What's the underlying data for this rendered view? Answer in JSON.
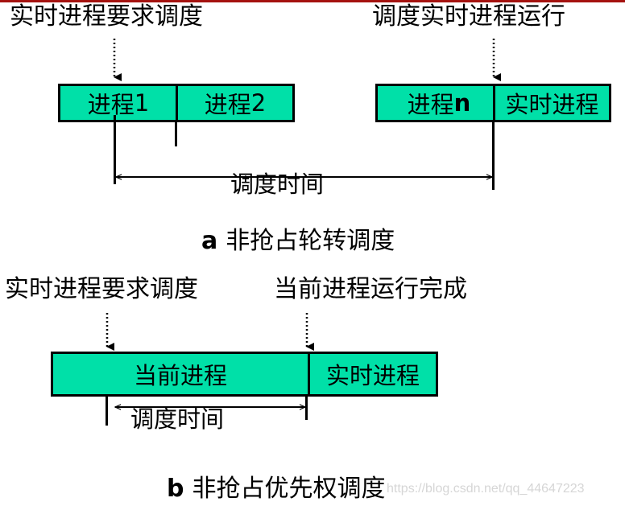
{
  "diagram_a": {
    "label_left": "实时进程要求调度",
    "label_right": "调度实时进程运行",
    "box_left": {
      "cells": [
        {
          "text": "进程",
          "suffix": "1"
        },
        {
          "text": "进程",
          "suffix": "2"
        }
      ]
    },
    "box_right": {
      "cells": [
        {
          "text": "进程",
          "suffix": "n"
        },
        {
          "text": "实时进程",
          "suffix": ""
        }
      ]
    },
    "interval_label": "调度时间",
    "caption_tag": "a",
    "caption_text": "非抢占轮转调度"
  },
  "diagram_b": {
    "label_left": "实时进程要求调度",
    "label_right": "当前进程运行完成",
    "box": {
      "cells": [
        {
          "text": "当前进程"
        },
        {
          "text": "实时进程"
        }
      ]
    },
    "interval_label": "调度时间",
    "caption_tag": "b",
    "caption_text": "非抢占优先权调度"
  },
  "watermark": "https://blog.csdn.net/qq_44647223",
  "colors": {
    "process_fill": "#00e0a8",
    "top_bar": "#a5120f",
    "watermark": "#d6d6d6"
  }
}
